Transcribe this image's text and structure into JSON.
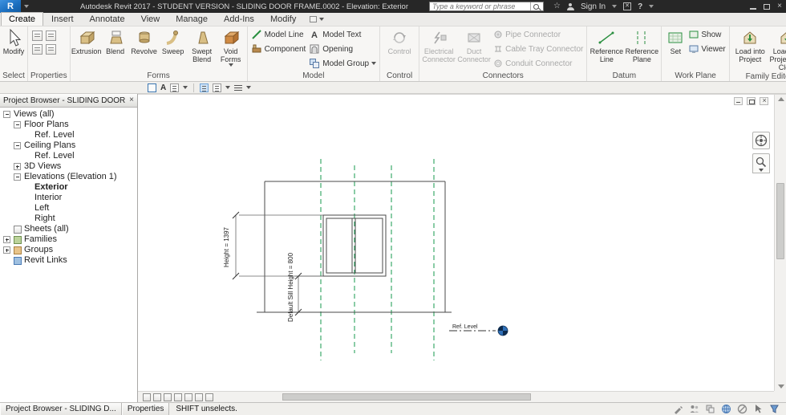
{
  "colors": {
    "ref_plane_green": "#15984c",
    "revit_blue": "#1b6fc0",
    "titlebar_bg": "#272727"
  },
  "icons": {
    "text_tool": "A",
    "help": "?",
    "star": "☆"
  },
  "titlebar": {
    "logo_letter": "R",
    "title": "Autodesk Revit 2017 - STUDENT VERSION - SLIDING DOOR FRAME.0002 - Elevation: Exterior",
    "search_placeholder": "Type a keyword or phrase",
    "sign_in": "Sign In"
  },
  "tabs": [
    "Create",
    "Insert",
    "Annotate",
    "View",
    "Manage",
    "Add-Ins",
    "Modify"
  ],
  "ribbon": {
    "select": {
      "button": "Modify",
      "label": "Select"
    },
    "properties_panel": {
      "label": "Properties"
    },
    "forms": {
      "label": "Forms",
      "items": [
        "Extrusion",
        "Blend",
        "Revolve",
        "Sweep",
        "Swept Blend",
        "Void Forms"
      ]
    },
    "model": {
      "label": "Model",
      "items": [
        "Model Line",
        "Component",
        "Model Text",
        "Opening",
        "Model Group"
      ]
    },
    "control": {
      "label": "Control",
      "button": "Control"
    },
    "connectors": {
      "label": "Connectors",
      "big": [
        "Electrical Connector",
        "Duct Connector"
      ],
      "small": [
        "Pipe Connector",
        "Cable Tray Connector",
        "Conduit Connector"
      ]
    },
    "datum": {
      "label": "Datum",
      "items": [
        "Reference Line",
        "Reference Plane"
      ]
    },
    "work_plane": {
      "label": "Work Plane",
      "big": "Set",
      "small": [
        "Show",
        "Viewer"
      ]
    },
    "family_editor": {
      "label": "Family Editor",
      "items": [
        "Load into Project",
        "Load into Project and Close"
      ]
    }
  },
  "project_browser": {
    "title": "Project Browser - SLIDING DOOR FRA...",
    "items": [
      {
        "label": "Views (all)"
      },
      {
        "label": "Floor Plans"
      },
      {
        "label": "Ref. Level"
      },
      {
        "label": "Ceiling Plans"
      },
      {
        "label": "Ref. Level"
      },
      {
        "label": "3D Views"
      },
      {
        "label": "Elevations (Elevation 1)"
      },
      {
        "label": "Exterior"
      },
      {
        "label": "Interior"
      },
      {
        "label": "Left"
      },
      {
        "label": "Right"
      },
      {
        "label": "Sheets (all)"
      },
      {
        "label": "Families"
      },
      {
        "label": "Groups"
      },
      {
        "label": "Revit Links"
      }
    ]
  },
  "canvas": {
    "height_dim": "Height = 1397",
    "sill_dim": "Default Sill Height = 800",
    "ref_level": "Ref. Level"
  },
  "statusbar": {
    "tab_browser": "Project Browser - SLIDING D...",
    "tab_properties": "Properties",
    "message": "SHIFT unselects."
  }
}
